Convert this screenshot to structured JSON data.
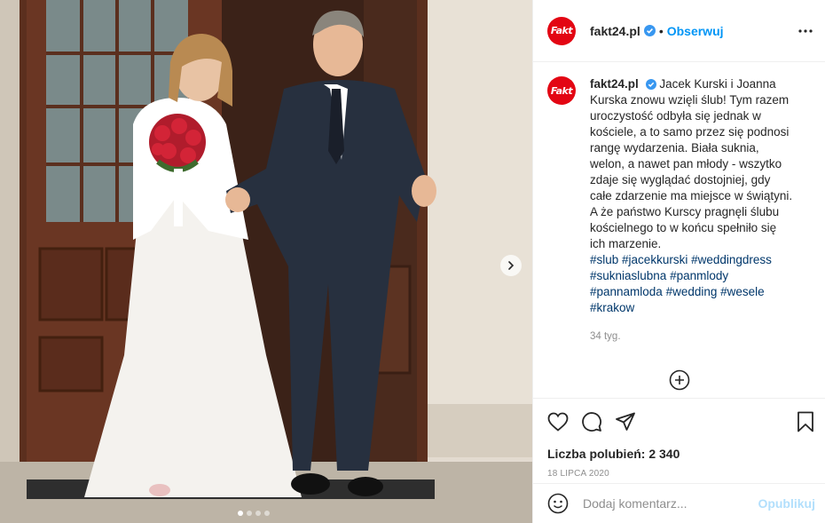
{
  "post": {
    "username": "fakt24.pl",
    "logo_text": "Fakt",
    "separator": "•",
    "follow_label": "Obserwuj",
    "caption_text": "Jacek Kurski i Joanna Kurska znowu wzięli ślub! Tym razem uroczystość odbyła się jednak w kościele, a to samo przez się podnosi rangę wydarzenia. Biała suknia, welon, a nawet pan młody - wszytko zdaje się wyglądać dostojniej, gdy całe zdarzenie ma miejsce w świątyni. A że państwo Kurscy pragnęli ślubu kościelnego to w końcu spełniło się ich marzenie.",
    "hashtags": [
      "#slub",
      "#jacekkurski",
      "#weddingdress",
      "#sukniaslubna",
      "#panmlody",
      "#pannamloda",
      "#wedding",
      "#wesele",
      "#krakow"
    ],
    "time_ago": "34 tyg.",
    "likes_text": "Liczba polubień: 2 340",
    "date_text": "18 LIPCA 2020"
  },
  "comment": {
    "placeholder": "Dodaj komentarz...",
    "publish_label": "Opublikuj"
  },
  "colors": {
    "brand": "#e30613",
    "link": "#0095f6",
    "hashtag": "#00376b",
    "muted": "#8e8e8e"
  },
  "icons": [
    "verified-badge-icon",
    "more-options-icon",
    "add-more-comments-icon",
    "heart-icon",
    "comment-icon",
    "share-icon",
    "bookmark-icon",
    "emoji-icon",
    "chevron-right-icon"
  ]
}
